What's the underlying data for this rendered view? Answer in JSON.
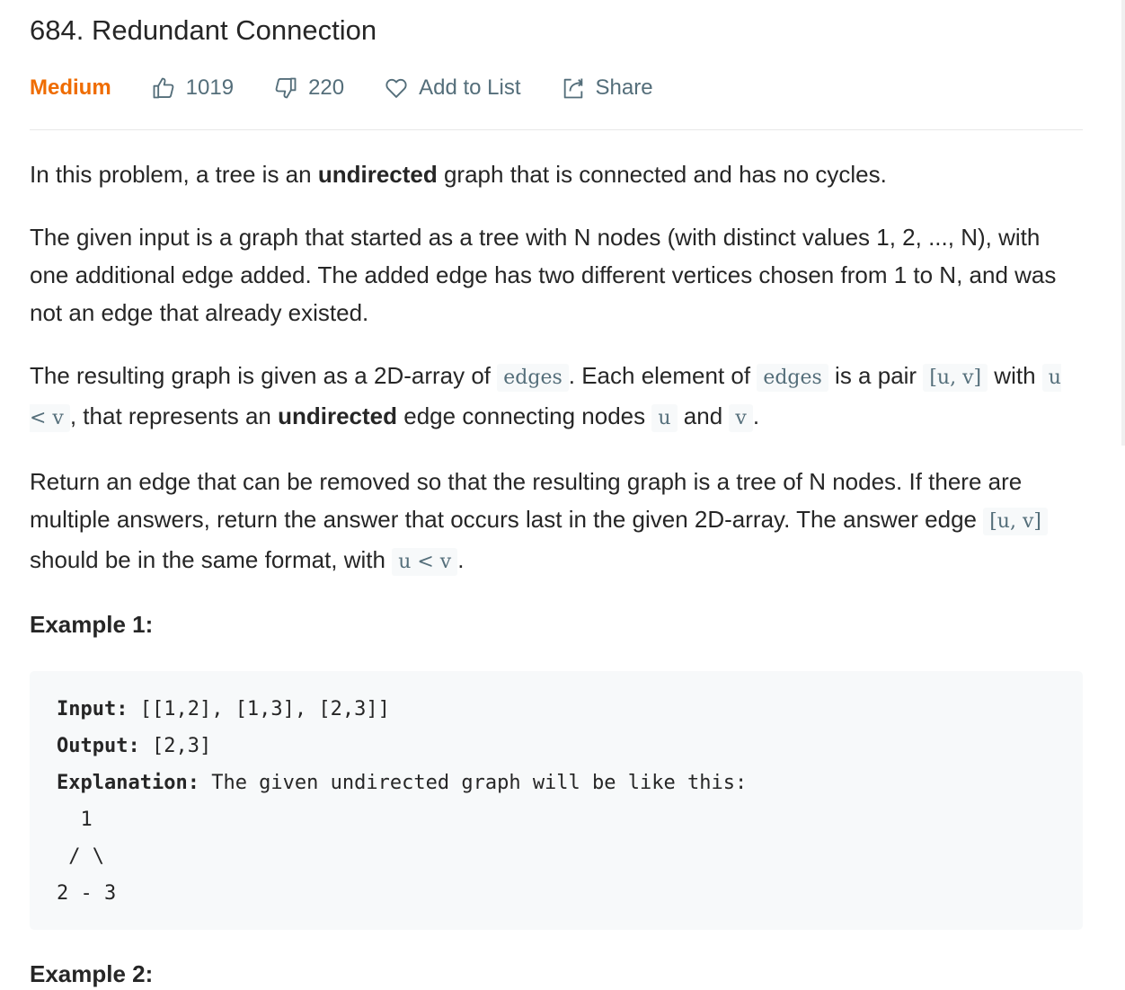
{
  "problem": {
    "title": "684. Redundant Connection",
    "difficulty": "Medium",
    "likes": "1019",
    "dislikes": "220",
    "add_to_list": "Add to List",
    "share": "Share",
    "difficulty_color": "#ef6c00"
  },
  "description": {
    "p1": {
      "a": "In this problem, a tree is an ",
      "b": "undirected",
      "c": " graph that is connected and has no cycles."
    },
    "p2": "The given input is a graph that started as a tree with N nodes (with distinct values 1, 2, ..., N), with one additional edge added. The added edge has two different vertices chosen from 1 to N, and was not an edge that already existed.",
    "p3": {
      "a": "The resulting graph is given as a 2D-array of ",
      "code1": "edges",
      "b": ". Each element of ",
      "code2": "edges",
      "c": " is a pair ",
      "code3": "[u, v]",
      "d": " with ",
      "code4": "u < v",
      "e": ", that represents an ",
      "f": "undirected",
      "g": " edge connecting nodes ",
      "code5": "u",
      "h": " and ",
      "code6": "v",
      "i": "."
    },
    "p4": {
      "a": "Return an edge that can be removed so that the resulting graph is a tree of N nodes. If there are multiple answers, return the answer that occurs last in the given 2D-array. The answer edge ",
      "code1": "[u, v]",
      "b": " should be in the same format, with ",
      "code2": "u < v",
      "c": "."
    }
  },
  "example1": {
    "heading": "Example 1:",
    "input_label": "Input:",
    "input_value": " [[1,2], [1,3], [2,3]]",
    "output_label": "Output:",
    "output_value": " [2,3]",
    "explanation_label": "Explanation:",
    "explanation_value": " The given undirected graph will be like this:",
    "diagram_line1": "  1",
    "diagram_line2": " / \\",
    "diagram_line3": "2 - 3"
  },
  "example2": {
    "heading": "Example 2:"
  },
  "icons": {
    "like": "thumbs-up-icon",
    "dislike": "thumbs-down-icon",
    "add": "heart-icon",
    "share": "share-icon"
  }
}
